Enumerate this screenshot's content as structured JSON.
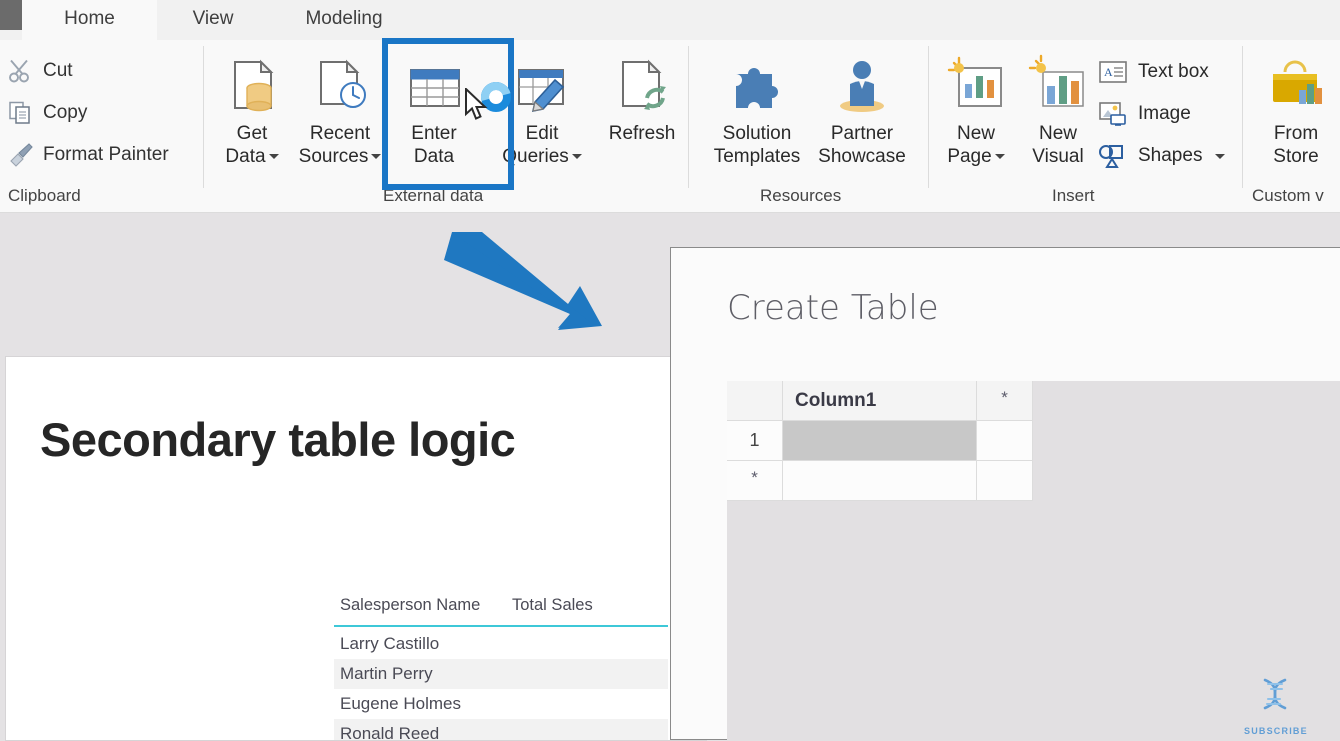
{
  "ribbon": {
    "tabs": [
      {
        "id": "home",
        "label": "Home",
        "active": true
      },
      {
        "id": "view",
        "label": "View",
        "active": false
      },
      {
        "id": "modeling",
        "label": "Modeling",
        "active": false
      }
    ],
    "groups": [
      {
        "id": "clipboard",
        "label": "Clipboard"
      },
      {
        "id": "external-data",
        "label": "External data"
      },
      {
        "id": "resources",
        "label": "Resources"
      },
      {
        "id": "insert",
        "label": "Insert"
      },
      {
        "id": "custom-visuals",
        "label": "Custom v"
      }
    ],
    "clipboard": {
      "cut": "Cut",
      "copy": "Copy",
      "format_painter": "Format Painter"
    },
    "external_data": {
      "get_data_l1": "Get",
      "get_data_l2": "Data",
      "recent_sources_l1": "Recent",
      "recent_sources_l2": "Sources",
      "enter_data_l1": "Enter",
      "enter_data_l2": "Data",
      "edit_queries_l1": "Edit",
      "edit_queries_l2": "Queries",
      "refresh": "Refresh"
    },
    "resources": {
      "solution_templates_l1": "Solution",
      "solution_templates_l2": "Templates",
      "partner_showcase_l1": "Partner",
      "partner_showcase_l2": "Showcase"
    },
    "insert": {
      "new_page_l1": "New",
      "new_page_l2": "Page",
      "new_visual_l1": "New",
      "new_visual_l2": "Visual",
      "text_box": "Text box",
      "image": "Image",
      "shapes": "Shapes"
    },
    "custom_visuals": {
      "from_store_l1": "From",
      "from_store_l2": "Store"
    },
    "highlight": {
      "target": "Enter Data",
      "color": "#1a76c6"
    }
  },
  "report": {
    "title": "Secondary table logic",
    "visual": {
      "columns": [
        "Salesperson Name",
        "Total Sales"
      ],
      "rows": [
        {
          "name": "Larry Castillo",
          "total_sales": ""
        },
        {
          "name": "Martin Perry",
          "total_sales": ""
        },
        {
          "name": "Eugene Holmes",
          "total_sales": ""
        },
        {
          "name": "Ronald Reed",
          "total_sales": ""
        }
      ]
    }
  },
  "dialog": {
    "title": "Create Table",
    "grid": {
      "column_header": "Column1",
      "new_column_marker": "*",
      "rows": [
        {
          "row_header": "1",
          "value": "",
          "selected": true
        },
        {
          "row_header": "*",
          "value": "",
          "selected": false
        }
      ]
    }
  },
  "annotations": {
    "arrow": {
      "color": "#1f78c1",
      "direction": "down-right"
    }
  },
  "watermark": {
    "label": "SUBSCRIBE",
    "icon": "dna-helix-icon",
    "color": "#5b9bd5"
  },
  "colors": {
    "accent_blue": "#1a76c6",
    "canvas_gray": "#e4e2e4",
    "ribbon_bg": "#f9f9f9",
    "teal_rule": "#3ec8d8"
  }
}
